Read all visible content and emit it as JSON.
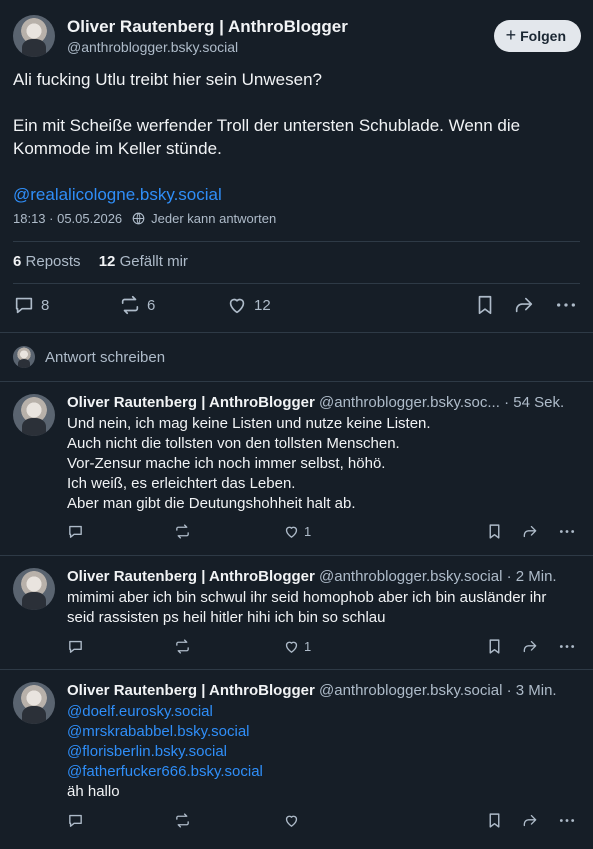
{
  "post": {
    "author_name": "Oliver Rautenberg | AnthroBlogger",
    "author_handle": "@anthroblogger.bsky.social",
    "follow_label": "Folgen",
    "text_line1": "Ali fucking Utlu treibt hier sein Unwesen?",
    "text_line2": "Ein mit Scheiße werfender Troll der untersten Schublade. Wenn die Kommode im Keller stünde.",
    "mention": "@realalicologne.bsky.social",
    "timestamp": "18:13 · 05.05.2026",
    "reply_setting": "Jeder kann antworten",
    "reposts_count": "6",
    "reposts_label": "Reposts",
    "likes_count": "12",
    "likes_label": "Gefällt mir",
    "actions": {
      "replies": "8",
      "reposts": "6",
      "likes": "12"
    }
  },
  "reply_bar": {
    "label": "Antwort schreiben"
  },
  "replies": [
    {
      "name": "Oliver Rautenberg | AnthroBlogger",
      "handle": "@anthroblogger.bsky.soc...",
      "time": "· 54 Sek.",
      "lines": [
        "Und nein, ich mag keine Listen und nutze keine Listen.",
        "Auch nicht die tollsten von den tollsten Menschen.",
        "Vor-Zensur mache ich noch immer selbst, höhö.",
        "Ich weiß, es erleichtert das Leben.",
        "Aber man gibt die Deutungshohheit halt ab."
      ],
      "likes": "1"
    },
    {
      "name": "Oliver Rautenberg | AnthroBlogger",
      "handle": "@anthroblogger.bsky.social",
      "time": "· 2 Min.",
      "lines": [
        "mimimi aber ich bin schwul ihr seid homophob aber ich bin ausländer ihr",
        "seid rassisten ps heil hitler hihi ich bin so schlau"
      ],
      "likes": "1"
    },
    {
      "name": "Oliver Rautenberg | AnthroBlogger",
      "handle": "@anthroblogger.bsky.social",
      "time": "· 3 Min.",
      "mentions": [
        "@doelf.eurosky.social",
        "@mrskrababbel.bsky.social",
        "@florisberlin.bsky.social",
        "@fatherfucker666.bsky.social"
      ],
      "text": "äh hallo",
      "likes": ""
    }
  ],
  "colors": {
    "background": "#161e27",
    "text": "#f1f3f5",
    "muted": "#aebbc9",
    "link": "#2f8ef8",
    "divider": "#2e3a46"
  },
  "icons": [
    "reply-icon",
    "repost-icon",
    "like-icon",
    "bookmark-icon",
    "share-icon",
    "more-icon",
    "globe-icon",
    "plus-icon"
  ]
}
